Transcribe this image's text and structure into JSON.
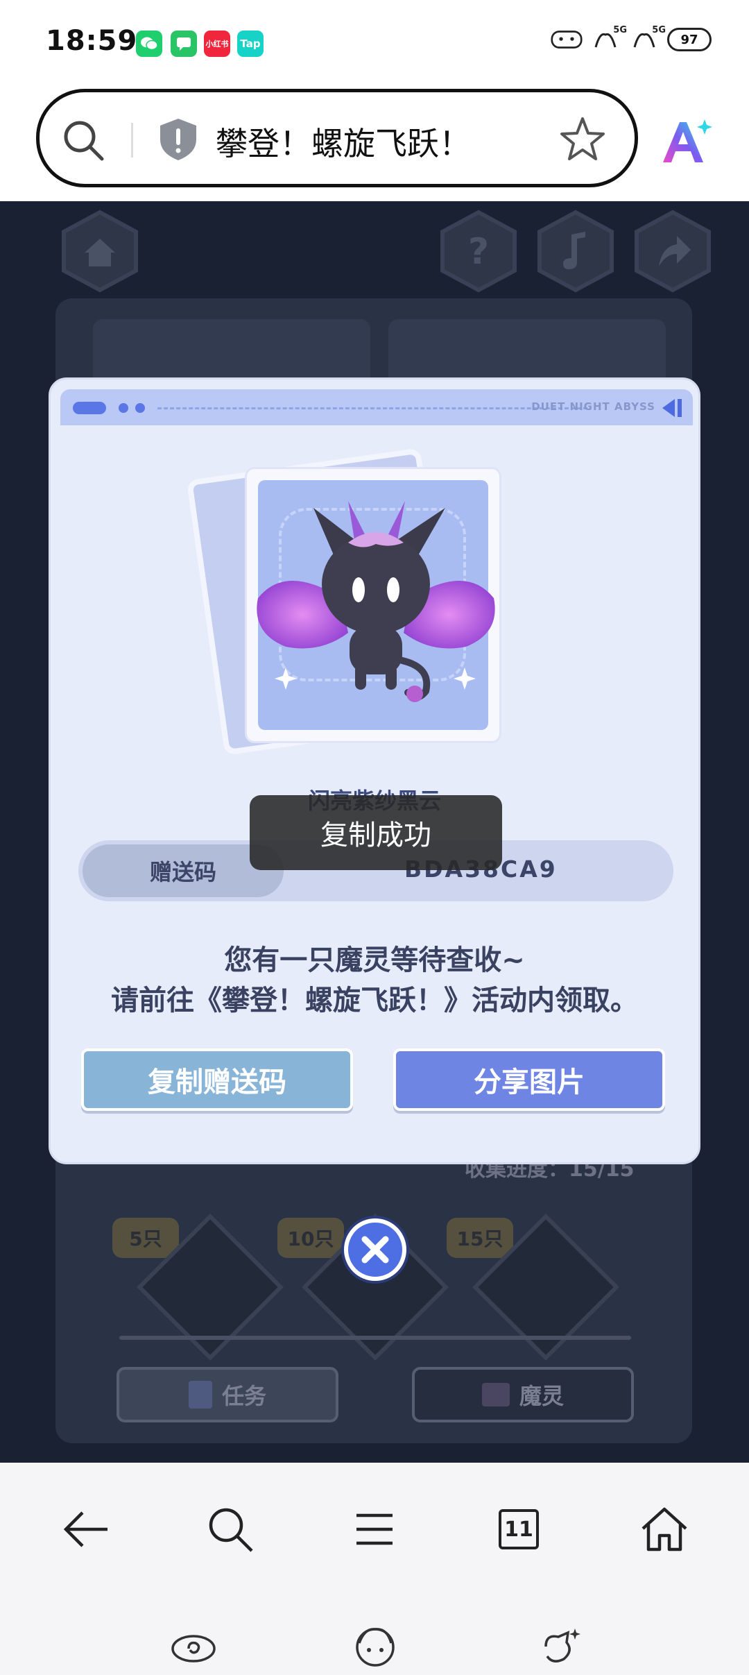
{
  "status_bar": {
    "time": "18:59",
    "notification_apps": [
      {
        "name": "wechat-icon",
        "label": "",
        "color": "#1fcf6d"
      },
      {
        "name": "messages-icon",
        "label": "",
        "color": "#29c465"
      },
      {
        "name": "xiaohongshu-icon",
        "label": "小红书",
        "color": "#f0263c"
      },
      {
        "name": "taptap-icon",
        "label": "Tap",
        "color": "#17d2c6"
      }
    ],
    "signal_1": "5G",
    "signal_2": "5G",
    "battery": "97"
  },
  "search_bar": {
    "query": "攀登！螺旋飞跃！"
  },
  "modal": {
    "header_brand": "DUET NIGHT ABYSS",
    "pet_name": "闪亮紫纱黑云",
    "code_label": "赠送码",
    "code_value": "BDA38CA9",
    "message_line1": "您有一只魔灵等待查收~",
    "message_line2": "请前往《攀登！螺旋飞跃！》活动内领取。",
    "copy_button": "复制赠送码",
    "share_button": "分享图片"
  },
  "toast": {
    "text": "复制成功"
  },
  "game_background": {
    "progress_text": "收集进度：15/15",
    "milestones": [
      "5只",
      "10只",
      "15只"
    ],
    "tab_task": "任务",
    "tab_spirit": "魔灵"
  },
  "bottom_nav": {
    "tab_count": "11"
  },
  "colors": {
    "modal_bg": "#e6ecf9",
    "accent_blue": "#6f85e4",
    "copy_button": "#88b4d8"
  }
}
